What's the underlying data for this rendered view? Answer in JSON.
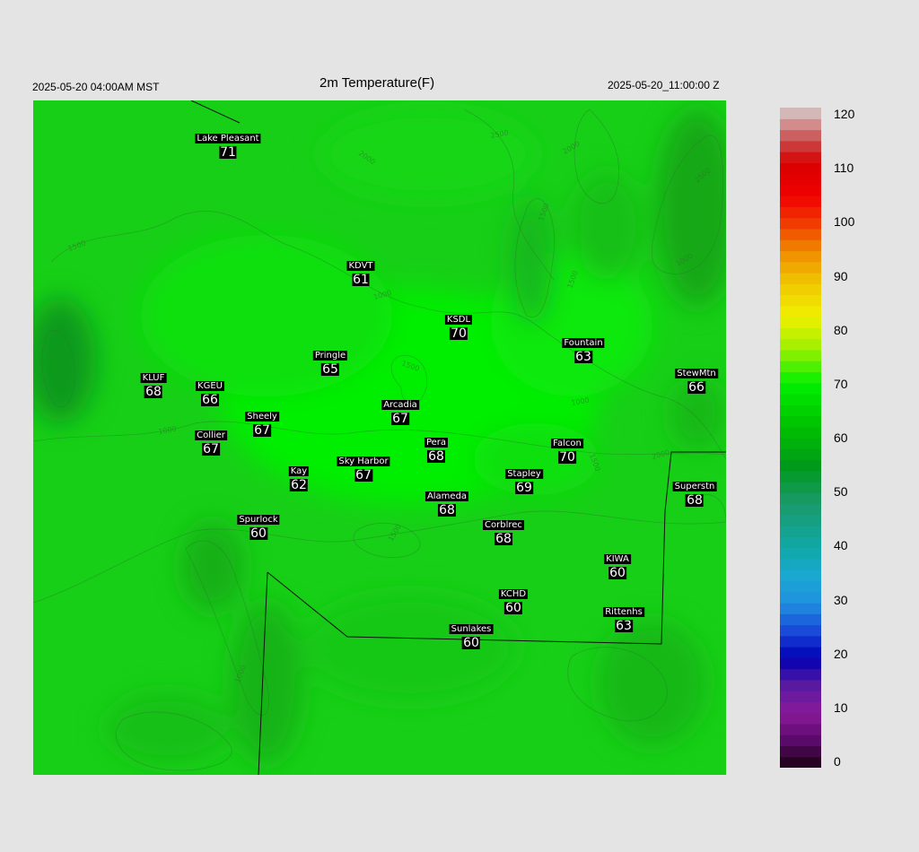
{
  "header": {
    "local_time": "2025-05-20 04:00AM MST",
    "title": "2m Temperature(F)",
    "utc_time": "2025-05-20_11:00:00 Z"
  },
  "stations": [
    {
      "name": "Lake Pleasant",
      "value": "71"
    },
    {
      "name": "KDVT",
      "value": "61"
    },
    {
      "name": "KSDL",
      "value": "70"
    },
    {
      "name": "Fountain",
      "value": "63"
    },
    {
      "name": "Pringle",
      "value": "65"
    },
    {
      "name": "KLUF",
      "value": "68"
    },
    {
      "name": "KGEU",
      "value": "66"
    },
    {
      "name": "StewMtn",
      "value": "66"
    },
    {
      "name": "Arcadia",
      "value": "67"
    },
    {
      "name": "Sheely",
      "value": "67"
    },
    {
      "name": "Collier",
      "value": "67"
    },
    {
      "name": "Pera",
      "value": "68"
    },
    {
      "name": "Falcon",
      "value": "70"
    },
    {
      "name": "Kay",
      "value": "62"
    },
    {
      "name": "Sky Harbor",
      "value": "67"
    },
    {
      "name": "Stapley",
      "value": "69"
    },
    {
      "name": "Superstn",
      "value": "68"
    },
    {
      "name": "Alameda",
      "value": "68"
    },
    {
      "name": "Spurlock",
      "value": "60"
    },
    {
      "name": "Corblrec",
      "value": "68"
    },
    {
      "name": "KIWA",
      "value": "60"
    },
    {
      "name": "KCHD",
      "value": "60"
    },
    {
      "name": "Rittenhs",
      "value": "63"
    },
    {
      "name": "Sunlakes",
      "value": "60"
    }
  ],
  "contour_labels": [
    "1500",
    "2000",
    "2500",
    "1000",
    "1500",
    "2000",
    "1000",
    "1500",
    "1500",
    "1000",
    "1000",
    "1500",
    "2000",
    "2500",
    "1500",
    "1000"
  ],
  "colorbar": {
    "ticks": [
      "120",
      "110",
      "100",
      "90",
      "80",
      "70",
      "60",
      "50",
      "40",
      "30",
      "20",
      "10",
      "0"
    ],
    "min": 0,
    "max": 120,
    "stops": [
      {
        "value": 0,
        "color": "#1a0010"
      },
      {
        "value": 5,
        "color": "#5a0a6a"
      },
      {
        "value": 10,
        "color": "#8a1a9a"
      },
      {
        "value": 15,
        "color": "#5a1aa0"
      },
      {
        "value": 20,
        "color": "#0000b4"
      },
      {
        "value": 25,
        "color": "#1a4ad8"
      },
      {
        "value": 30,
        "color": "#2090e0"
      },
      {
        "value": 35,
        "color": "#1aa8d0"
      },
      {
        "value": 40,
        "color": "#10a8a8"
      },
      {
        "value": 48,
        "color": "#1a9a6a"
      },
      {
        "value": 55,
        "color": "#009a1a"
      },
      {
        "value": 62,
        "color": "#00c000"
      },
      {
        "value": 70,
        "color": "#00f000"
      },
      {
        "value": 76,
        "color": "#9af000"
      },
      {
        "value": 82,
        "color": "#f0f000"
      },
      {
        "value": 88,
        "color": "#f0c800"
      },
      {
        "value": 94,
        "color": "#f08a00"
      },
      {
        "value": 99,
        "color": "#f03c00"
      },
      {
        "value": 104,
        "color": "#f00000"
      },
      {
        "value": 110,
        "color": "#d80000"
      },
      {
        "value": 114,
        "color": "#c84a4a"
      },
      {
        "value": 118,
        "color": "#d8a0a0"
      },
      {
        "value": 120,
        "color": "#d0d0d0"
      }
    ]
  },
  "colors": {
    "background": "#e4e4e4",
    "map_base": "#19d219",
    "label_bg": "#000000",
    "label_text": "#ffffff"
  }
}
